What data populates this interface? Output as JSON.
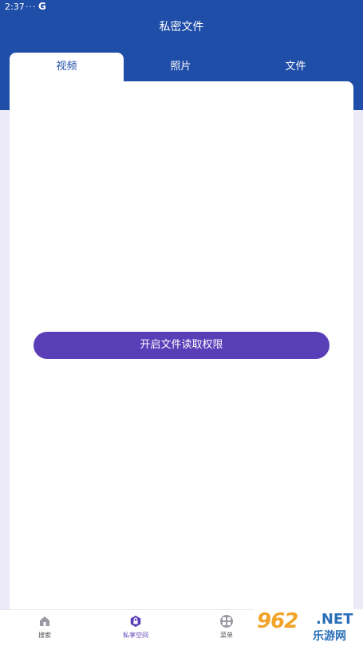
{
  "status_bar": {
    "time": "2:37",
    "dots": "···",
    "g_label": "G"
  },
  "header": {
    "title": "私密文件"
  },
  "tabs": [
    {
      "label": "视频",
      "active": true
    },
    {
      "label": "照片",
      "active": false
    },
    {
      "label": "文件",
      "active": false
    }
  ],
  "content": {
    "permission_button_label": "开启文件读取权限"
  },
  "bottom_nav": [
    {
      "label": "搜索",
      "icon": "home-icon",
      "active": false
    },
    {
      "label": "私享空间",
      "icon": "lock-icon",
      "active": true
    },
    {
      "label": "菜单",
      "icon": "grid-icon",
      "active": false
    }
  ],
  "watermark": {
    "number": "962",
    "net": ".NET",
    "site_name": "乐游网"
  },
  "colors": {
    "header": "#1f4ea8",
    "accent": "#5a3eb8",
    "background": "#eceaf7"
  }
}
